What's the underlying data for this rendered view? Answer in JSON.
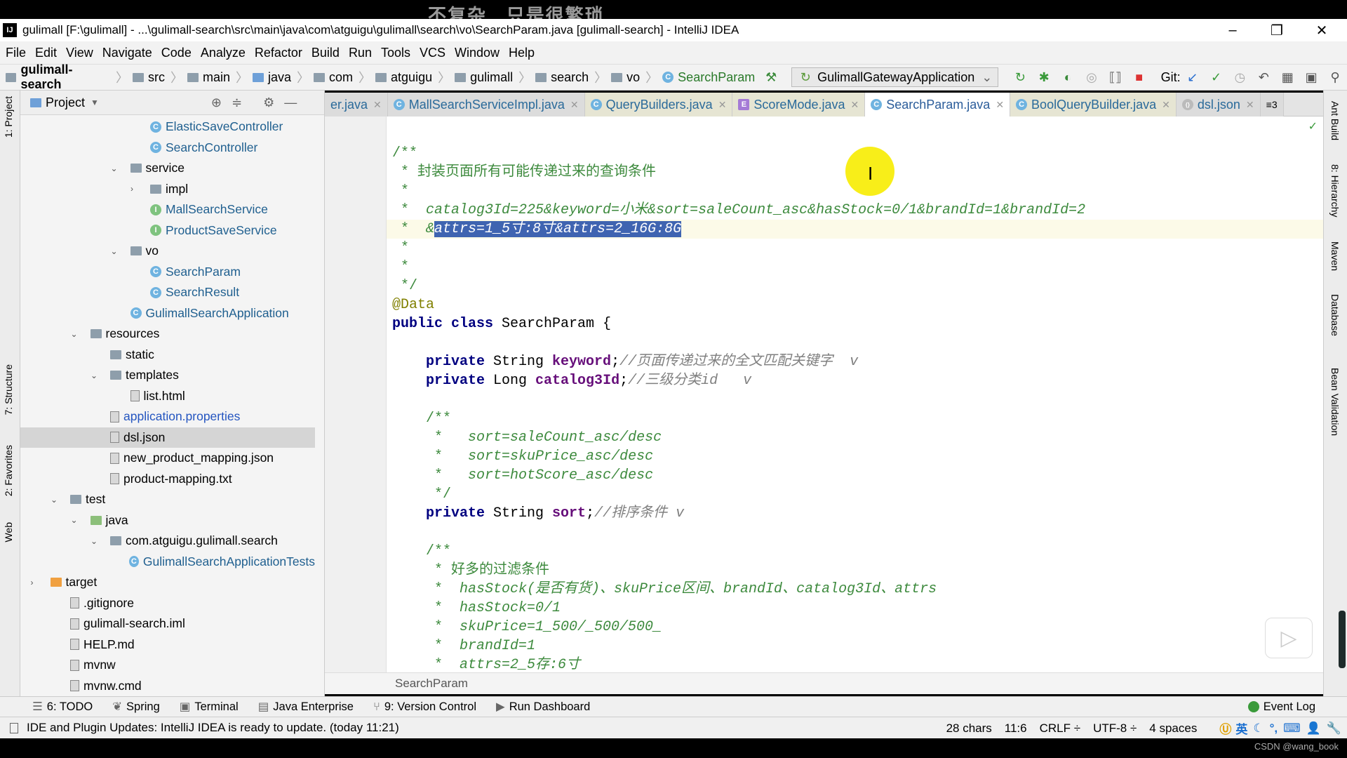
{
  "watermark_top": "不复杂   只是很繁琐",
  "watermark_bottom": "CSDN @wang_book",
  "window": {
    "title": "gulimall [F:\\gulimall] - ...\\gulimall-search\\src\\main\\java\\com\\atguigu\\gulimall\\search\\vo\\SearchParam.java [gulimall-search] - IntelliJ IDEA",
    "logo": "IJ",
    "minimize": "–",
    "restore": "❐",
    "close": "✕"
  },
  "menu": [
    "File",
    "Edit",
    "View",
    "Navigate",
    "Code",
    "Analyze",
    "Refactor",
    "Build",
    "Run",
    "Tools",
    "VCS",
    "Window",
    "Help"
  ],
  "breadcrumb": [
    {
      "label": "gulimall-search",
      "icon": "module-folder-icon"
    },
    {
      "label": "src",
      "icon": "folder-icon"
    },
    {
      "label": "main",
      "icon": "folder-icon"
    },
    {
      "label": "java",
      "icon": "source-folder-icon"
    },
    {
      "label": "com",
      "icon": "folder-icon"
    },
    {
      "label": "atguigu",
      "icon": "folder-icon"
    },
    {
      "label": "gulimall",
      "icon": "folder-icon"
    },
    {
      "label": "search",
      "icon": "folder-icon"
    },
    {
      "label": "vo",
      "icon": "folder-icon"
    },
    {
      "label": "SearchParam",
      "icon": "class-icon"
    }
  ],
  "run_config": "GulimallGatewayApplication",
  "git_label": "Git:",
  "project_panel": {
    "title": "Project"
  },
  "tree": [
    {
      "label": "ElasticSaveController",
      "level": 6,
      "icon": "class",
      "arrow": ""
    },
    {
      "label": "SearchController",
      "level": 6,
      "icon": "class",
      "arrow": ""
    },
    {
      "label": "service",
      "level": 5,
      "icon": "folder",
      "arrow": "open"
    },
    {
      "label": "impl",
      "level": 6,
      "icon": "folder",
      "arrow": "closed"
    },
    {
      "label": "MallSearchService",
      "level": 6,
      "icon": "interface",
      "arrow": ""
    },
    {
      "label": "ProductSaveService",
      "level": 6,
      "icon": "interface",
      "arrow": ""
    },
    {
      "label": "vo",
      "level": 5,
      "icon": "folder",
      "arrow": "open"
    },
    {
      "label": "SearchParam",
      "level": 6,
      "icon": "class",
      "arrow": ""
    },
    {
      "label": "SearchResult",
      "level": 6,
      "icon": "class",
      "arrow": ""
    },
    {
      "label": "GulimallSearchApplication",
      "level": 5,
      "icon": "class",
      "arrow": ""
    },
    {
      "label": "resources",
      "level": 3,
      "icon": "folder",
      "arrow": "open"
    },
    {
      "label": "static",
      "level": 4,
      "icon": "folder",
      "arrow": ""
    },
    {
      "label": "templates",
      "level": 4,
      "icon": "folder",
      "arrow": "open"
    },
    {
      "label": "list.html",
      "level": 5,
      "icon": "file",
      "arrow": ""
    },
    {
      "label": "application.properties",
      "level": 4,
      "icon": "file",
      "arrow": "",
      "link": true
    },
    {
      "label": "dsl.json",
      "level": 4,
      "icon": "file",
      "arrow": "",
      "selected": true
    },
    {
      "label": "new_product_mapping.json",
      "level": 4,
      "icon": "file",
      "arrow": ""
    },
    {
      "label": "product-mapping.txt",
      "level": 4,
      "icon": "file",
      "arrow": ""
    },
    {
      "label": "test",
      "level": 2,
      "icon": "folder",
      "arrow": "open"
    },
    {
      "label": "java",
      "level": 3,
      "icon": "folder-green",
      "arrow": "open"
    },
    {
      "label": "com.atguigu.gulimall.search",
      "level": 4,
      "icon": "folder",
      "arrow": "open"
    },
    {
      "label": "GulimallSearchApplicationTests",
      "level": 5,
      "icon": "class",
      "arrow": ""
    },
    {
      "label": "target",
      "level": 1,
      "icon": "folder-orange",
      "arrow": "closed"
    },
    {
      "label": ".gitignore",
      "level": 2,
      "icon": "file",
      "arrow": ""
    },
    {
      "label": "gulimall-search.iml",
      "level": 2,
      "icon": "file",
      "arrow": ""
    },
    {
      "label": "HELP.md",
      "level": 2,
      "icon": "file",
      "arrow": ""
    },
    {
      "label": "mvnw",
      "level": 2,
      "icon": "file",
      "arrow": ""
    },
    {
      "label": "mvnw.cmd",
      "level": 2,
      "icon": "file",
      "arrow": ""
    }
  ],
  "tabs": [
    {
      "label": "er.java",
      "icon": "",
      "style": "plain"
    },
    {
      "label": "MallSearchServiceImpl.java",
      "icon": "C",
      "style": "plain"
    },
    {
      "label": "QueryBuilders.java",
      "icon": "C",
      "style": "tinted"
    },
    {
      "label": "ScoreMode.java",
      "icon": "E",
      "style": "tinted"
    },
    {
      "label": "SearchParam.java",
      "icon": "C",
      "style": "active"
    },
    {
      "label": "BoolQueryBuilder.java",
      "icon": "C",
      "style": "tinted"
    },
    {
      "label": "dsl.json",
      "icon": "{}",
      "style": "plain"
    }
  ],
  "tabs_overflow": "≡3",
  "current_line": 11,
  "code": [
    {
      "n": 6,
      "seg": []
    },
    {
      "n": 7,
      "fold": true,
      "seg": [
        [
          "docz",
          "/**"
        ]
      ]
    },
    {
      "n": 8,
      "seg": [
        [
          "docz",
          " * 封装页面所有可能传递过来的查询条件"
        ]
      ]
    },
    {
      "n": 9,
      "seg": [
        [
          "docz",
          " *"
        ]
      ]
    },
    {
      "n": 10,
      "seg": [
        [
          "docz",
          " *  "
        ],
        [
          "doc",
          "catalog3Id=225&keyword=小米&sort=saleCount_asc&hasStock=0/1&brandId=1&brandId=2"
        ]
      ]
    },
    {
      "n": 11,
      "seg": [
        [
          "docz",
          " *  "
        ],
        [
          "doc",
          "&"
        ],
        [
          "sel",
          "attrs=1_5寸:8寸&attrs=2_16G:8G"
        ]
      ]
    },
    {
      "n": 12,
      "seg": [
        [
          "docz",
          " *"
        ]
      ]
    },
    {
      "n": 13,
      "seg": [
        [
          "docz",
          " *"
        ]
      ]
    },
    {
      "n": 14,
      "fold": true,
      "seg": [
        [
          "docz",
          " */"
        ]
      ]
    },
    {
      "n": 15,
      "seg": [
        [
          "ann",
          "@Data"
        ]
      ]
    },
    {
      "n": 16,
      "seg": [
        [
          "kw",
          "public class "
        ],
        [
          "plain",
          "SearchParam {"
        ]
      ]
    },
    {
      "n": 17,
      "seg": []
    },
    {
      "n": 18,
      "seg": [
        [
          "plain",
          "    "
        ],
        [
          "kw",
          "private "
        ],
        [
          "plain",
          "String "
        ],
        [
          "field",
          "keyword"
        ],
        [
          "plain",
          ";"
        ],
        [
          "cmt",
          "//页面传递过来的全文匹配关键字  v"
        ]
      ]
    },
    {
      "n": 19,
      "seg": [
        [
          "plain",
          "    "
        ],
        [
          "kw",
          "private "
        ],
        [
          "plain",
          "Long "
        ],
        [
          "field",
          "catalog3Id"
        ],
        [
          "plain",
          ";"
        ],
        [
          "cmt",
          "//三级分类id   v"
        ]
      ]
    },
    {
      "n": 20,
      "seg": []
    },
    {
      "n": 21,
      "fold": true,
      "seg": [
        [
          "docz",
          "    /**"
        ]
      ]
    },
    {
      "n": 22,
      "seg": [
        [
          "docz",
          "     *   "
        ],
        [
          "doc",
          "sort=saleCount_asc/desc"
        ]
      ]
    },
    {
      "n": 23,
      "seg": [
        [
          "docz",
          "     *   "
        ],
        [
          "doc",
          "sort=skuPrice_asc/desc"
        ]
      ]
    },
    {
      "n": 24,
      "seg": [
        [
          "docz",
          "     *   "
        ],
        [
          "doc",
          "sort=hotScore_asc/desc"
        ]
      ]
    },
    {
      "n": 25,
      "fold": true,
      "seg": [
        [
          "docz",
          "     */"
        ]
      ]
    },
    {
      "n": 26,
      "seg": [
        [
          "plain",
          "    "
        ],
        [
          "kw",
          "private "
        ],
        [
          "plain",
          "String "
        ],
        [
          "field",
          "sort"
        ],
        [
          "plain",
          ";"
        ],
        [
          "cmt",
          "//排序条件 v"
        ]
      ]
    },
    {
      "n": 27,
      "seg": []
    },
    {
      "n": 28,
      "fold": true,
      "seg": [
        [
          "docz",
          "    /**"
        ]
      ]
    },
    {
      "n": 29,
      "seg": [
        [
          "docz",
          "     * 好多的过滤条件"
        ]
      ]
    },
    {
      "n": 30,
      "seg": [
        [
          "docz",
          "     *  "
        ],
        [
          "doc",
          "hasStock(是否有货)、skuPrice区间、brandId、catalog3Id、attrs"
        ]
      ]
    },
    {
      "n": 31,
      "seg": [
        [
          "docz",
          "     *  "
        ],
        [
          "doc",
          "hasStock=0/1"
        ]
      ]
    },
    {
      "n": 32,
      "seg": [
        [
          "docz",
          "     *  "
        ],
        [
          "doc",
          "skuPrice=1_500/_500/500_"
        ]
      ]
    },
    {
      "n": 33,
      "seg": [
        [
          "docz",
          "     *  "
        ],
        [
          "doc",
          "brandId=1"
        ]
      ]
    },
    {
      "n": 34,
      "seg": [
        [
          "docz",
          "     *  "
        ],
        [
          "doc",
          "attrs=2_5存:6寸"
        ]
      ]
    }
  ],
  "editor_breadcrumb": "SearchParam",
  "left_stripe": [
    "1: Project",
    "7: Structure",
    "2: Favorites",
    "Web"
  ],
  "right_stripe": [
    "Ant Build",
    "8: Hierarchy",
    "Maven",
    "Database",
    "Bean Validation"
  ],
  "tool_windows": [
    {
      "label": "6: TODO",
      "icon": "☰"
    },
    {
      "label": "Spring",
      "icon": "❦"
    },
    {
      "label": "Terminal",
      "icon": "▣"
    },
    {
      "label": "Java Enterprise",
      "icon": "▤"
    },
    {
      "label": "9: Version Control",
      "icon": "⑂"
    },
    {
      "label": "Run Dashboard",
      "icon": "▶"
    }
  ],
  "event_log": "Event Log",
  "status": {
    "message": "IDE and Plugin Updates: IntelliJ IDEA is ready to update. (today 11:21)",
    "chars": "28 chars",
    "position": "11:6",
    "line_sep": "CRLF ÷",
    "encoding": "UTF-8 ÷",
    "indent": "4 spaces",
    "ime": "英"
  }
}
